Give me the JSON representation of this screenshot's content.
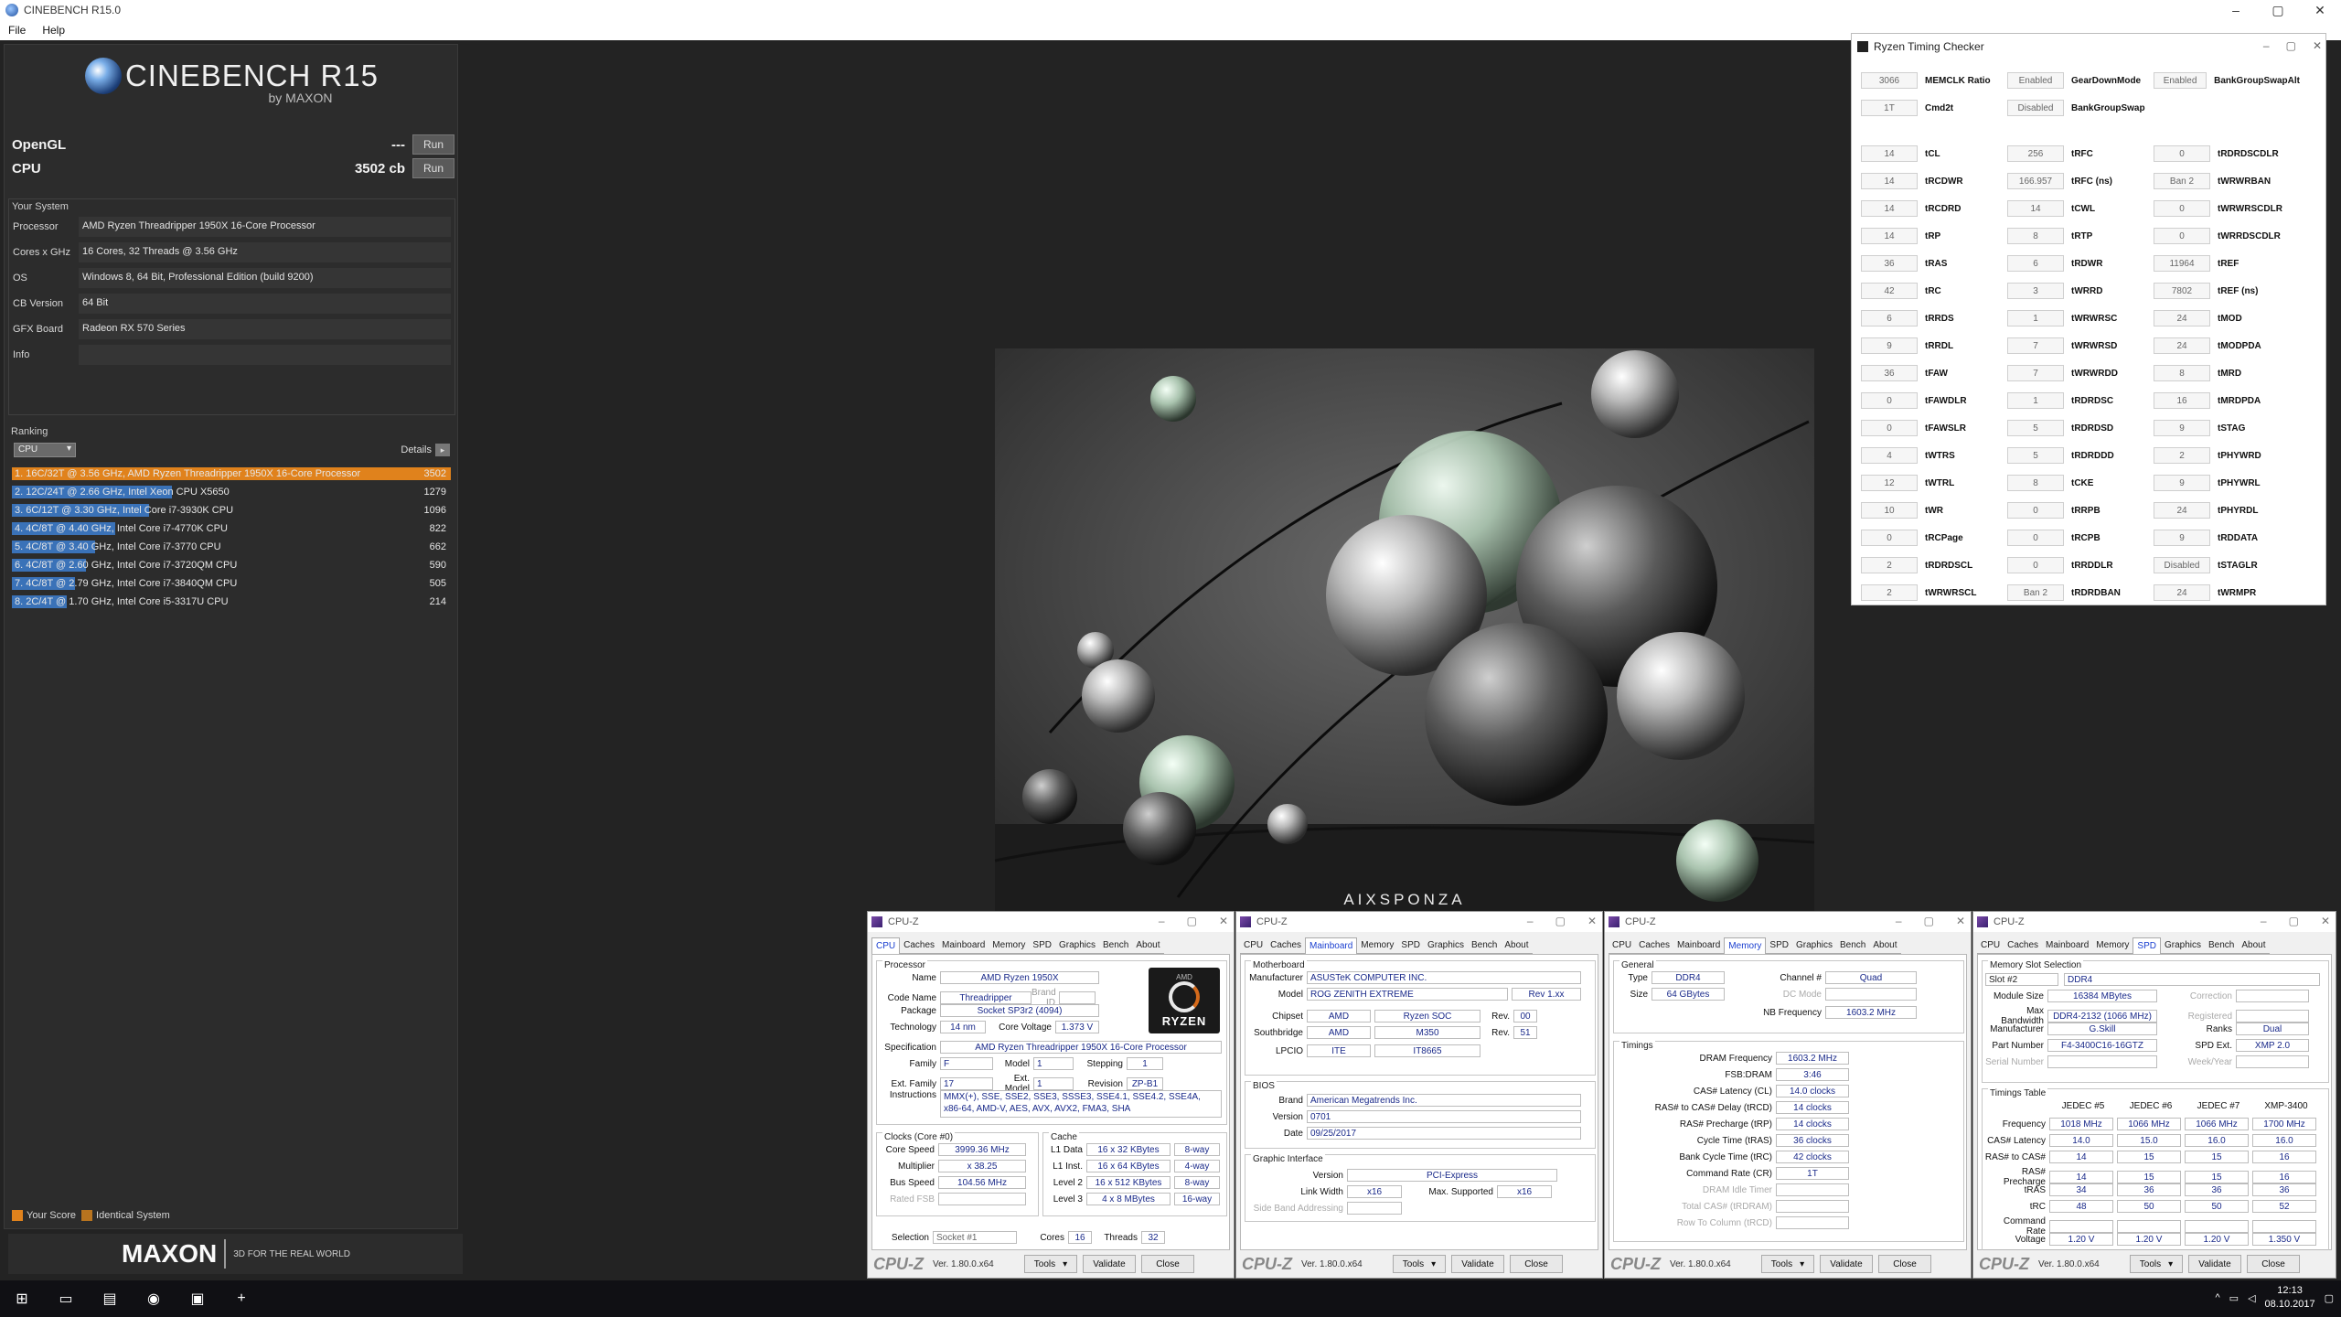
{
  "window": {
    "title": "CINEBENCH R15.0"
  },
  "menu": [
    "File",
    "Help"
  ],
  "cinebench": {
    "brand": "CINEBENCH R15",
    "by": "by MAXON",
    "opengl_label": "OpenGL",
    "opengl_value": "---",
    "cpu_label": "CPU",
    "cpu_value": "3502 cb",
    "run_label": "Run",
    "system_header": "Your System",
    "system": [
      {
        "k": "Processor",
        "v": "AMD Ryzen Threadripper 1950X 16-Core Processor"
      },
      {
        "k": "Cores x GHz",
        "v": "16 Cores, 32 Threads @ 3.56 GHz"
      },
      {
        "k": "OS",
        "v": "Windows 8, 64 Bit, Professional Edition (build 9200)"
      },
      {
        "k": "CB Version",
        "v": "64 Bit"
      },
      {
        "k": "GFX Board",
        "v": "Radeon RX 570 Series"
      },
      {
        "k": "Info",
        "v": ""
      }
    ],
    "ranking_header": "Ranking",
    "ranking_select": "CPU",
    "details_label": "Details",
    "ranking": [
      {
        "text": "1. 16C/32T @ 3.56 GHz, AMD Ryzen Threadripper 1950X 16-Core Processor",
        "score": 3502,
        "me": true
      },
      {
        "text": "2. 12C/24T @ 2.66 GHz, Intel Xeon CPU X5650",
        "score": 1279,
        "me": false
      },
      {
        "text": "3. 6C/12T @ 3.30 GHz,  Intel Core i7-3930K CPU",
        "score": 1096,
        "me": false
      },
      {
        "text": "4. 4C/8T @ 4.40 GHz, Intel Core i7-4770K CPU",
        "score": 822,
        "me": false
      },
      {
        "text": "5. 4C/8T @ 3.40 GHz,  Intel Core i7-3770 CPU",
        "score": 662,
        "me": false
      },
      {
        "text": "6. 4C/8T @ 2.60 GHz, Intel Core i7-3720QM CPU",
        "score": 590,
        "me": false
      },
      {
        "text": "7. 4C/8T @ 2.79 GHz,  Intel Core i7-3840QM CPU",
        "score": 505,
        "me": false
      },
      {
        "text": "8. 2C/4T @ 1.70 GHz,  Intel Core i5-3317U CPU",
        "score": 214,
        "me": false
      }
    ],
    "legend_your": "Your Score",
    "legend_identical": "Identical System",
    "footer_brand": "MAXON",
    "footer_tag": "3D FOR THE REAL WORLD",
    "colors": {
      "me": "#e0821c",
      "other": "#3a72b8"
    }
  },
  "render": {
    "watermark": "AIXSPONZA"
  },
  "rtc": {
    "title": "Ryzen Timing Checker",
    "rows": [
      [
        [
          "3066",
          "MEMCLK Ratio"
        ],
        [
          "Enabled",
          "GearDownMode"
        ],
        [
          "Enabled",
          "BankGroupSwapAlt"
        ]
      ],
      [
        [
          "1T",
          "Cmd2t"
        ],
        [
          "Disabled",
          "BankGroupSwap"
        ],
        [
          "",
          ""
        ]
      ],
      [
        [
          "14",
          "tCL"
        ],
        [
          "256",
          "tRFC"
        ],
        [
          "0",
          "tRDRDSCDLR"
        ]
      ],
      [
        [
          "14",
          "tRCDWR"
        ],
        [
          "166.957",
          "tRFC (ns)"
        ],
        [
          "Ban 2",
          "tWRWRBAN"
        ]
      ],
      [
        [
          "14",
          "tRCDRD"
        ],
        [
          "14",
          "tCWL"
        ],
        [
          "0",
          "tWRWRSCDLR"
        ]
      ],
      [
        [
          "14",
          "tRP"
        ],
        [
          "8",
          "tRTP"
        ],
        [
          "0",
          "tWRRDSCDLR"
        ]
      ],
      [
        [
          "36",
          "tRAS"
        ],
        [
          "6",
          "tRDWR"
        ],
        [
          "11964",
          "tREF"
        ]
      ],
      [
        [
          "42",
          "tRC"
        ],
        [
          "3",
          "tWRRD"
        ],
        [
          "7802",
          "tREF (ns)"
        ]
      ],
      [
        [
          "6",
          "tRRDS"
        ],
        [
          "1",
          "tWRWRSC"
        ],
        [
          "24",
          "tMOD"
        ]
      ],
      [
        [
          "9",
          "tRRDL"
        ],
        [
          "7",
          "tWRWRSD"
        ],
        [
          "24",
          "tMODPDA"
        ]
      ],
      [
        [
          "36",
          "tFAW"
        ],
        [
          "7",
          "tWRWRDD"
        ],
        [
          "8",
          "tMRD"
        ]
      ],
      [
        [
          "0",
          "tFAWDLR"
        ],
        [
          "1",
          "tRDRDSC"
        ],
        [
          "16",
          "tMRDPDA"
        ]
      ],
      [
        [
          "0",
          "tFAWSLR"
        ],
        [
          "5",
          "tRDRDSD"
        ],
        [
          "9",
          "tSTAG"
        ]
      ],
      [
        [
          "4",
          "tWTRS"
        ],
        [
          "5",
          "tRDRDDD"
        ],
        [
          "2",
          "tPHYWRD"
        ]
      ],
      [
        [
          "12",
          "tWTRL"
        ],
        [
          "8",
          "tCKE"
        ],
        [
          "9",
          "tPHYWRL"
        ]
      ],
      [
        [
          "10",
          "tWR"
        ],
        [
          "0",
          "tRRPB"
        ],
        [
          "24",
          "tPHYRDL"
        ]
      ],
      [
        [
          "0",
          "tRCPage"
        ],
        [
          "0",
          "tRCPB"
        ],
        [
          "9",
          "tRDDATA"
        ]
      ],
      [
        [
          "2",
          "tRDRDSCL"
        ],
        [
          "0",
          "tRRDDLR"
        ],
        [
          "Disabled",
          "tSTAGLR"
        ]
      ],
      [
        [
          "2",
          "tWRWRSCL"
        ],
        [
          "Ban 2",
          "tRDRDBAN"
        ],
        [
          "24",
          "tWRMPR"
        ]
      ]
    ]
  },
  "cpuz": {
    "title": "CPU-Z",
    "tabs": [
      "CPU",
      "Caches",
      "Mainboard",
      "Memory",
      "SPD",
      "Graphics",
      "Bench",
      "About"
    ],
    "version": "Ver. 1.80.0.x64",
    "brand": "CPU-Z",
    "tools": "Tools",
    "validate": "Validate",
    "close": "Close",
    "cpu": {
      "group_processor": "Processor",
      "name_k": "Name",
      "name": "AMD Ryzen 1950X",
      "code_k": "Code Name",
      "code": "Threadripper",
      "brandid_k": "Brand ID",
      "pkg_k": "Package",
      "pkg": "Socket SP3r2 (4094)",
      "tech_k": "Technology",
      "tech": "14 nm",
      "cv_k": "Core Voltage",
      "cv": "1.373 V",
      "spec_k": "Specification",
      "spec": "AMD Ryzen Threadripper 1950X 16-Core Processor",
      "fam_k": "Family",
      "fam": "F",
      "model_k": "Model",
      "model": "1",
      "step_k": "Stepping",
      "step": "1",
      "efam_k": "Ext. Family",
      "efam": "17",
      "emodel_k": "Ext. Model",
      "emodel": "1",
      "rev_k": "Revision",
      "rev": "ZP-B1",
      "instr_k": "Instructions",
      "instr": "MMX(+), SSE, SSE2, SSE3, SSSE3, SSE4.1, SSE4.2, SSE4A, x86-64, AMD-V, AES, AVX, AVX2, FMA3, SHA",
      "group_clocks": "Clocks (Core #0)",
      "cs_k": "Core Speed",
      "cs": "3999.36 MHz",
      "mul_k": "Multiplier",
      "mul": "x 38.25",
      "bus_k": "Bus Speed",
      "bus": "104.56 MHz",
      "fsb_k": "Rated FSB",
      "group_cache": "Cache",
      "l1d_k": "L1 Data",
      "l1d": "16 x 32 KBytes",
      "l1d_w": "8-way",
      "l1i_k": "L1 Inst.",
      "l1i": "16 x 64 KBytes",
      "l1i_w": "4-way",
      "l2_k": "Level 2",
      "l2": "16 x 512 KBytes",
      "l2_w": "8-way",
      "l3_k": "Level 3",
      "l3": "4 x 8 MBytes",
      "l3_w": "16-way",
      "sel_k": "Selection",
      "sel": "Socket #1",
      "cores_k": "Cores",
      "cores": "16",
      "threads_k": "Threads",
      "threads": "32",
      "badge_top": "AMD",
      "badge": "RYZEN"
    },
    "mb": {
      "group_mb": "Motherboard",
      "man_k": "Manufacturer",
      "man": "ASUSTeK COMPUTER INC.",
      "model_k": "Model",
      "model": "ROG ZENITH EXTREME",
      "model_rev": "Rev 1.xx",
      "chip_k": "Chipset",
      "chip": "AMD",
      "chip2": "Ryzen SOC",
      "chip_rev_k": "Rev.",
      "chip_rev": "00",
      "sb_k": "Southbridge",
      "sb": "AMD",
      "sb2": "M350",
      "sb_rev_k": "Rev.",
      "sb_rev": "51",
      "lpc_k": "LPCIO",
      "lpc": "ITE",
      "lpc2": "IT8665",
      "group_bios": "BIOS",
      "bb_k": "Brand",
      "bb": "American Megatrends Inc.",
      "bv_k": "Version",
      "bv": "0701",
      "bd_k": "Date",
      "bd": "09/25/2017",
      "group_gi": "Graphic Interface",
      "gv_k": "Version",
      "gv": "PCI-Express",
      "lw_k": "Link Width",
      "lw": "x16",
      "ms_k": "Max. Supported",
      "ms": "x16",
      "sba_k": "Side Band Addressing"
    },
    "mem": {
      "group_gen": "General",
      "type_k": "Type",
      "type": "DDR4",
      "ch_k": "Channel #",
      "ch": "Quad",
      "size_k": "Size",
      "size": "64 GBytes",
      "dc_k": "DC Mode",
      "nb_k": "NB Frequency",
      "nb": "1603.2 MHz",
      "group_tim": "Timings",
      "t": [
        [
          "DRAM Frequency",
          "1603.2 MHz"
        ],
        [
          "FSB:DRAM",
          "3:46"
        ],
        [
          "CAS# Latency (CL)",
          "14.0 clocks"
        ],
        [
          "RAS# to CAS# Delay (tRCD)",
          "14 clocks"
        ],
        [
          "RAS# Precharge (tRP)",
          "14 clocks"
        ],
        [
          "Cycle Time (tRAS)",
          "36 clocks"
        ],
        [
          "Bank Cycle Time (tRC)",
          "42 clocks"
        ],
        [
          "Command Rate (CR)",
          "1T"
        ],
        [
          "DRAM Idle Timer",
          ""
        ],
        [
          "Total CAS# (tRDRAM)",
          ""
        ],
        [
          "Row To Column (tRCD)",
          ""
        ]
      ]
    },
    "spd": {
      "group_slot": "Memory Slot Selection",
      "slot": "Slot #2",
      "slot_type": "DDR4",
      "ms_k": "Module Size",
      "ms": "16384 MBytes",
      "corr_k": "Correction",
      "mb_k": "Max Bandwidth",
      "mb": "DDR4-2132 (1066 MHz)",
      "reg_k": "Registered",
      "man_k": "Manufacturer",
      "man": "G.Skill",
      "ranks_k": "Ranks",
      "ranks": "Dual",
      "pn_k": "Part Number",
      "pn": "F4-3400C16-16GTZ",
      "spd_k": "SPD Ext.",
      "spd": "XMP 2.0",
      "sn_k": "Serial Number",
      "wy_k": "Week/Year",
      "group_tt": "Timings Table",
      "cols": [
        "JEDEC #5",
        "JEDEC #6",
        "JEDEC #7",
        "XMP-3400"
      ],
      "rows": [
        [
          "Frequency",
          "1018 MHz",
          "1066 MHz",
          "1066 MHz",
          "1700 MHz"
        ],
        [
          "CAS# Latency",
          "14.0",
          "15.0",
          "16.0",
          "16.0"
        ],
        [
          "RAS# to CAS#",
          "14",
          "15",
          "15",
          "16"
        ],
        [
          "RAS# Precharge",
          "14",
          "15",
          "15",
          "16"
        ],
        [
          "tRAS",
          "34",
          "36",
          "36",
          "36"
        ],
        [
          "tRC",
          "48",
          "50",
          "50",
          "52"
        ],
        [
          "Command Rate",
          "",
          "",
          "",
          ""
        ],
        [
          "Voltage",
          "1.20 V",
          "1.20 V",
          "1.20 V",
          "1.350 V"
        ]
      ]
    }
  },
  "taskbar": {
    "time": "12:13",
    "date": "08.10.2017"
  }
}
